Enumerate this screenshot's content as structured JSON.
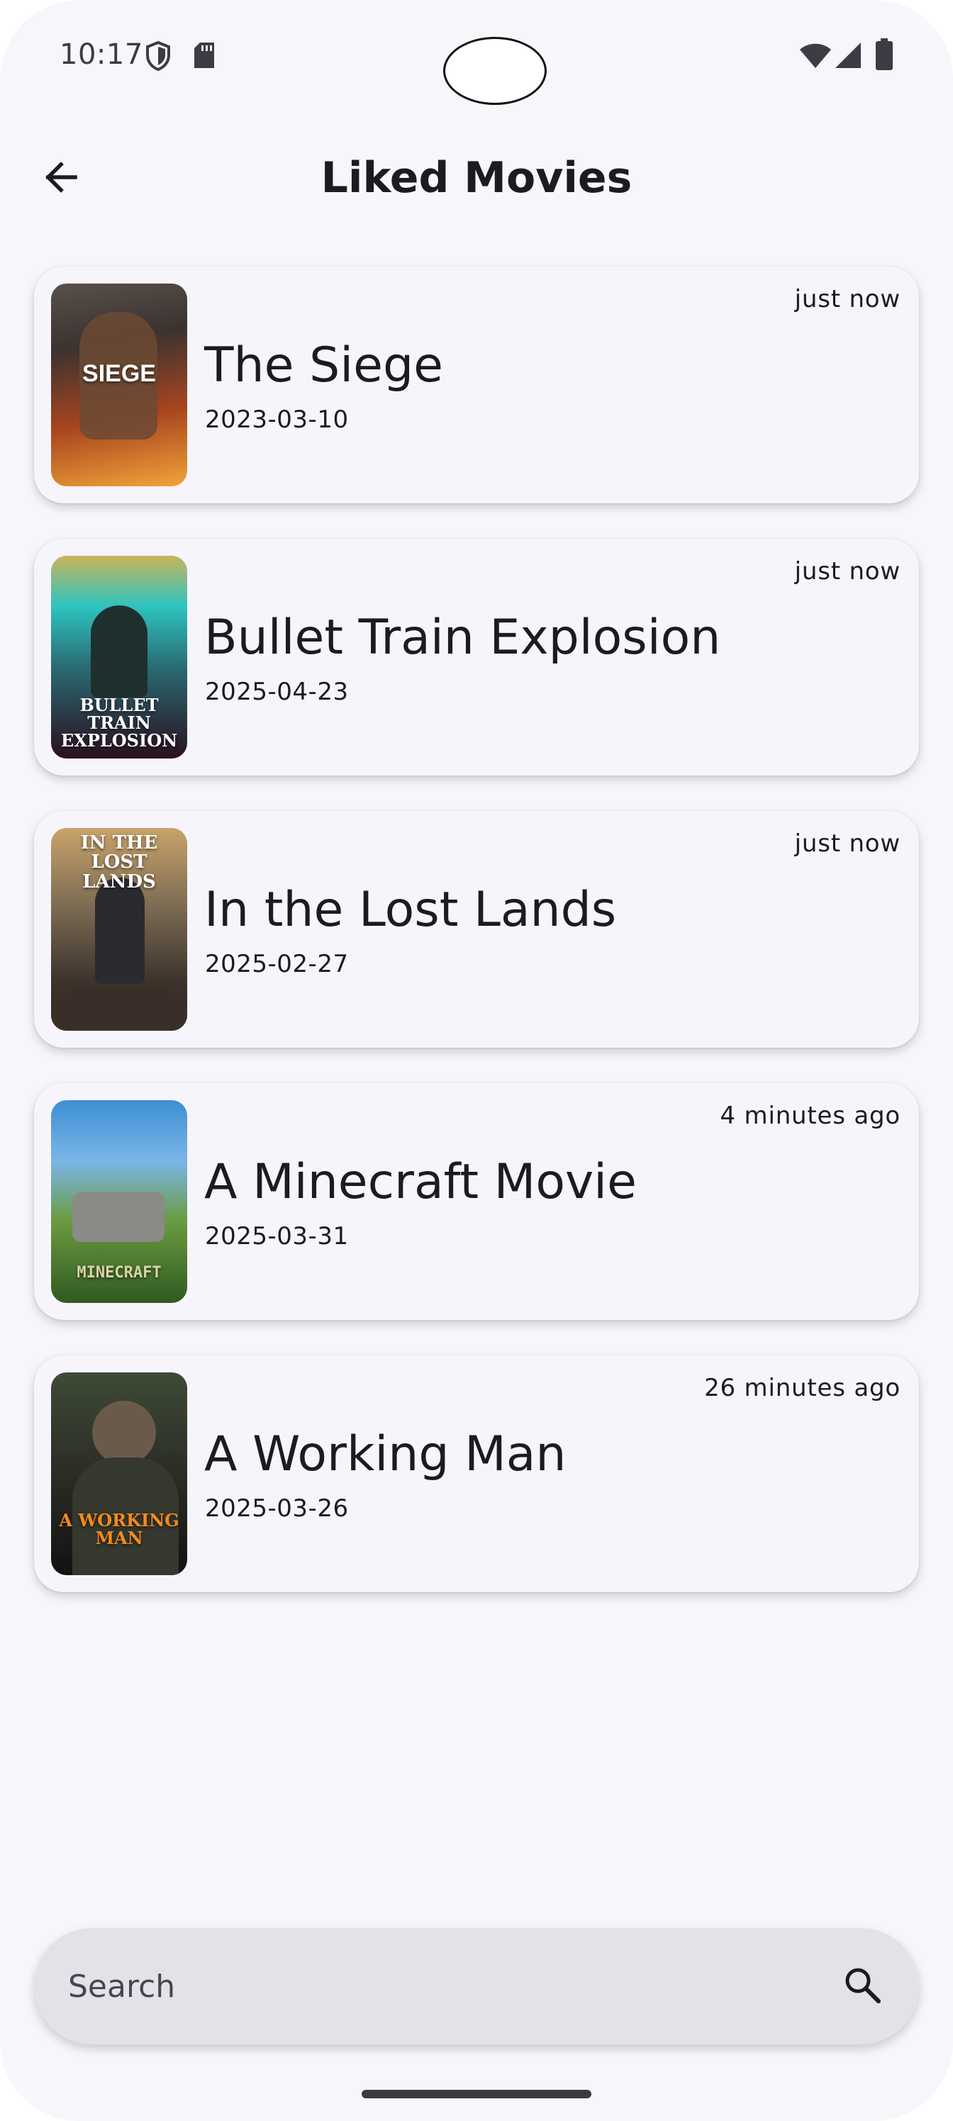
{
  "status_bar": {
    "time": "10:17",
    "left_icons": [
      "shield-icon",
      "sd-card-icon"
    ],
    "right_icons": [
      "wifi-icon",
      "cellular-icon",
      "battery-icon"
    ]
  },
  "app_bar": {
    "title": "Liked Movies",
    "back_icon": "arrow-back-icon"
  },
  "movies": [
    {
      "title": "The Siege",
      "date": "2023-03-10",
      "time_ago": "just now",
      "poster_text": "SIEGE",
      "poster_colors": [
        "#3b3330",
        "#c4441a",
        "#f2a33a"
      ]
    },
    {
      "title": "Bullet Train Explosion",
      "date": "2025-04-23",
      "time_ago": "just now",
      "poster_text": "BULLET TRAIN EXPLOSION",
      "poster_colors": [
        "#2ec4c0",
        "#2a6a72",
        "#2a1020"
      ]
    },
    {
      "title": "In the Lost Lands",
      "date": "2025-02-27",
      "time_ago": "just now",
      "poster_text": "IN THE LOST LANDS",
      "poster_colors": [
        "#c9a36a",
        "#5b4a3a",
        "#2a2420"
      ]
    },
    {
      "title": "A Minecraft Movie",
      "date": "2025-03-31",
      "time_ago": "4 minutes ago",
      "poster_text": "MINECRAFT",
      "poster_colors": [
        "#3d8fd1",
        "#6a9a3e",
        "#2f5a22"
      ]
    },
    {
      "title": "A Working Man",
      "date": "2025-03-26",
      "time_ago": "26 minutes ago",
      "poster_text": "A WORKING MAN",
      "poster_colors": [
        "#3e4a36",
        "#2a2a24",
        "#121212"
      ]
    }
  ],
  "search": {
    "placeholder": "Search",
    "value": "",
    "icon": "search-icon"
  },
  "colors": {
    "background": "#f7f6fb",
    "card": "#f7f5fc",
    "search_bar": "#e3e2e8",
    "text": "#1d1b20"
  }
}
